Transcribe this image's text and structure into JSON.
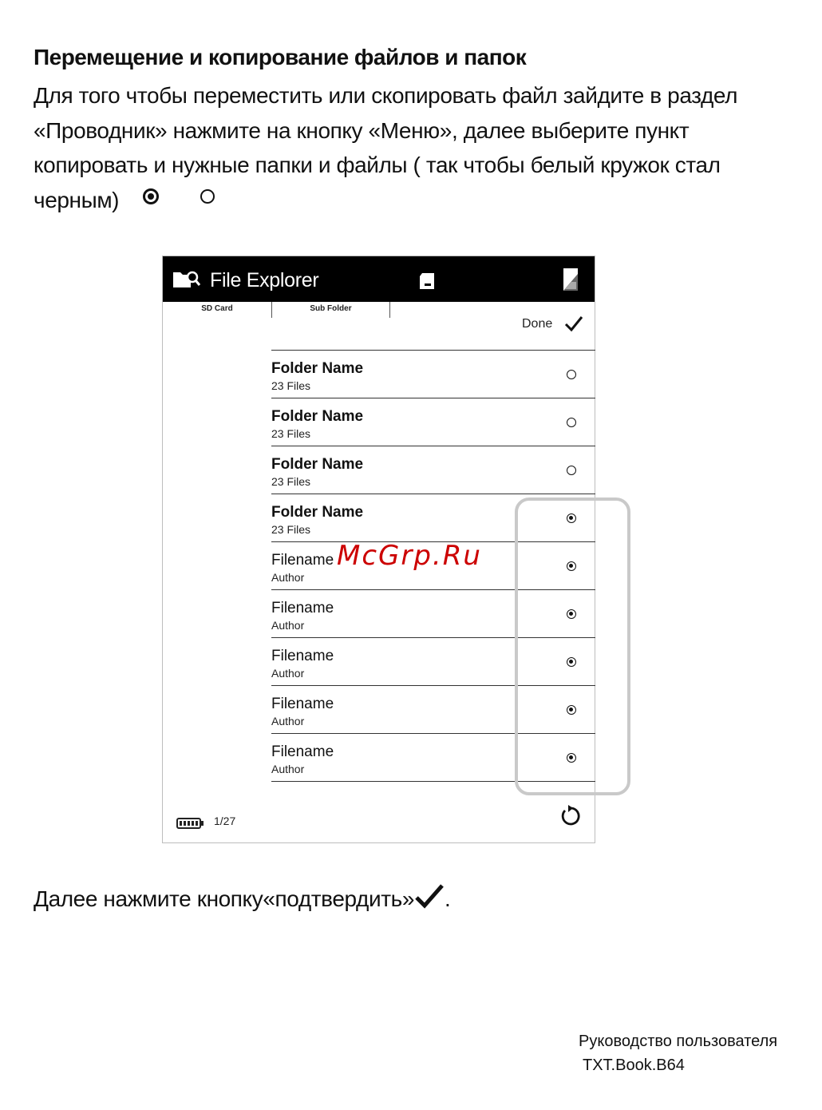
{
  "heading": "Перемещение и копирование файлов и папок",
  "intro_text": "Для того чтобы переместить или скопировать файл зайдите в раздел «Проводник» нажмите на кнопку «Меню», далее выберите пункт копировать и нужные папки и файлы ( так чтобы белый кружок стал черным)",
  "inline_icons": [
    "radio-filled-icon",
    "radio-empty-icon"
  ],
  "screen": {
    "title": "File Explorer",
    "tabs": [
      "SD Card",
      "Sub Folder"
    ],
    "done_label": "Done",
    "rows": [
      {
        "title": "Folder Name",
        "subtitle": "23 Files",
        "bold": true,
        "selected": false
      },
      {
        "title": "Folder Name",
        "subtitle": "23 Files",
        "bold": true,
        "selected": false
      },
      {
        "title": "Folder Name",
        "subtitle": "23 Files",
        "bold": true,
        "selected": false
      },
      {
        "title": "Folder Name",
        "subtitle": "23 Files",
        "bold": true,
        "selected": true
      },
      {
        "title": "Filename",
        "subtitle": "Author",
        "bold": false,
        "selected": true
      },
      {
        "title": "Filename",
        "subtitle": "Author",
        "bold": false,
        "selected": true
      },
      {
        "title": "Filename",
        "subtitle": "Author",
        "bold": false,
        "selected": true
      },
      {
        "title": "Filename",
        "subtitle": "Author",
        "bold": false,
        "selected": true
      },
      {
        "title": "Filename",
        "subtitle": "Author",
        "bold": false,
        "selected": true
      }
    ],
    "page_indicator": "1/27"
  },
  "watermark": "McGrp.Ru",
  "bottom_text": "Далее нажмите кнопку«подтвердить»",
  "bottom_text_end": ".",
  "footer": {
    "line1": "Руководство пользователя",
    "line2": "TXT.Book.B64"
  }
}
